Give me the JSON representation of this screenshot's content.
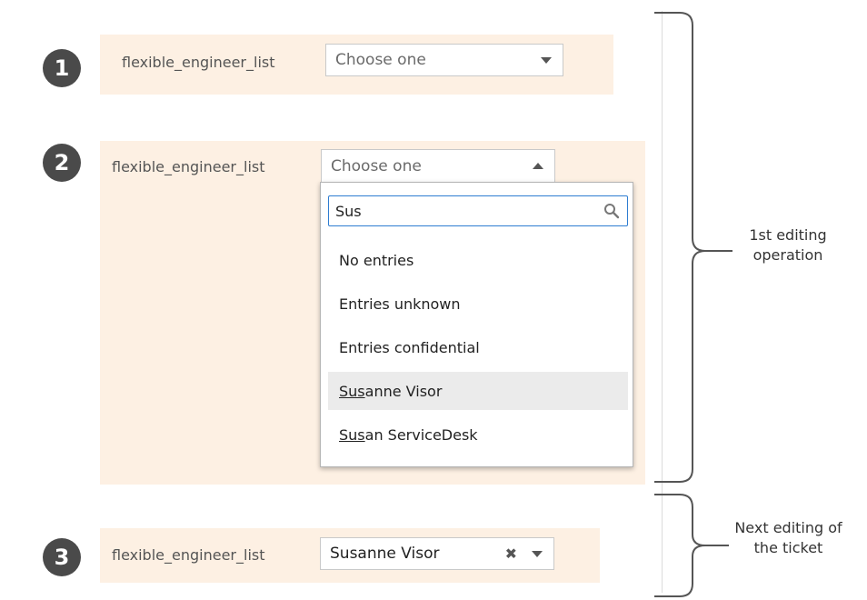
{
  "steps": {
    "one": {
      "number": "1",
      "label": "flexible_engineer_list",
      "placeholder": "Choose one"
    },
    "two": {
      "number": "2",
      "label": "flexible_engineer_list",
      "placeholder": "Choose one",
      "search_value": "Sus",
      "options": [
        {
          "label": "No entries"
        },
        {
          "label": "Entries unknown"
        },
        {
          "label": "Entries confidential"
        },
        {
          "match": "Sus",
          "rest": "anne Visor",
          "highlighted": true
        },
        {
          "match": "Sus",
          "rest": "an ServiceDesk"
        }
      ]
    },
    "three": {
      "number": "3",
      "label": "flexible_engineer_list",
      "selected_value": "Susanne Visor",
      "clear_glyph": "✖"
    }
  },
  "annotations": {
    "first": [
      "1st editing",
      "operation"
    ],
    "next": [
      "Next editing of",
      "the ticket"
    ]
  },
  "colors": {
    "panel_background": "#fdf0e3",
    "badge_background": "#4a4a4a",
    "search_focus_border": "#2e7dd1",
    "highlighted_option": "#ebebeb"
  },
  "icons": [
    "step-number-badge",
    "chevron-down-icon",
    "chevron-up-icon",
    "search-icon",
    "clear-icon",
    "curly-bracket-icon"
  ]
}
